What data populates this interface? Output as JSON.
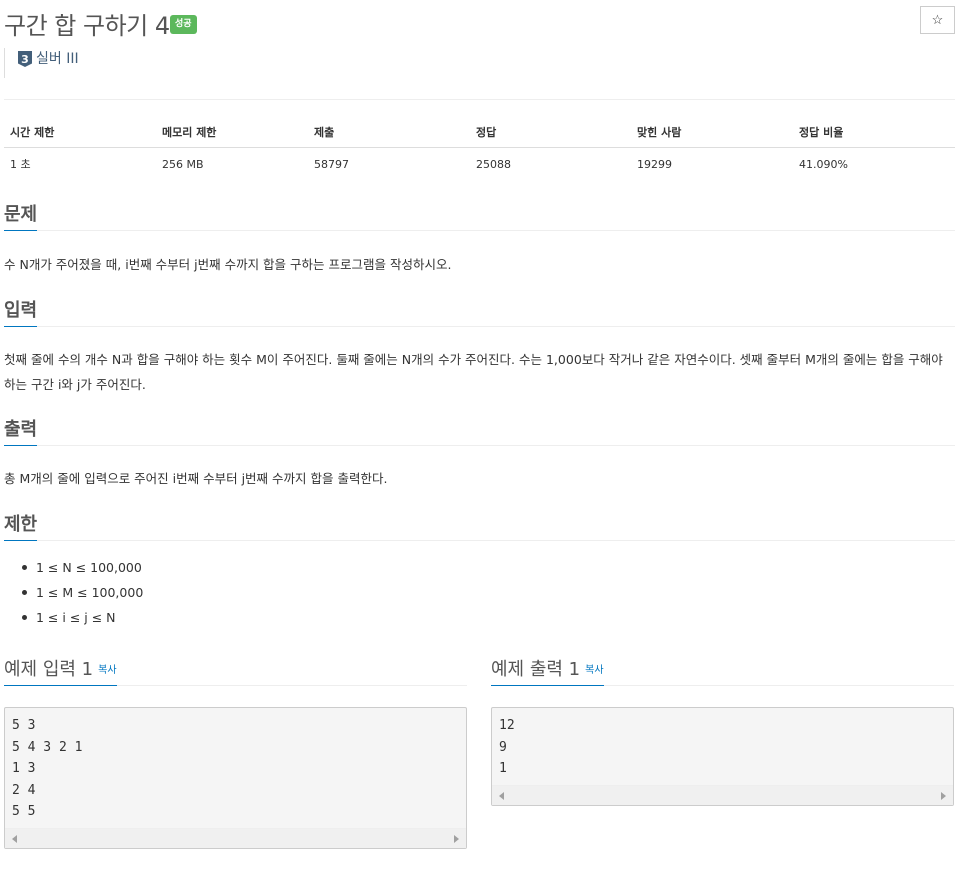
{
  "problem": {
    "title": "구간 합 구하기 4",
    "badge": "성공",
    "star": "☆",
    "tier_number": "3",
    "tier_label": "실버 III",
    "colors": {
      "badge": "#5cb85c",
      "tier": "#435f7a",
      "accent": "#0076c0"
    }
  },
  "info_table": {
    "headers": [
      "시간 제한",
      "메모리 제한",
      "제출",
      "정답",
      "맞힌 사람",
      "정답 비율"
    ],
    "values": [
      "1 초",
      "256 MB",
      "58797",
      "25088",
      "19299",
      "41.090%"
    ]
  },
  "sections": {
    "description": {
      "title": "문제",
      "text": "수 N개가 주어졌을 때, i번째 수부터 j번째 수까지 합을 구하는 프로그램을 작성하시오."
    },
    "input": {
      "title": "입력",
      "text": "첫째 줄에 수의 개수 N과 합을 구해야 하는 횟수 M이 주어진다. 둘째 줄에는 N개의 수가 주어진다. 수는 1,000보다 작거나 같은 자연수이다. 셋째 줄부터 M개의 줄에는 합을 구해야 하는 구간 i와 j가 주어진다."
    },
    "output": {
      "title": "출력",
      "text": "총 M개의 줄에 입력으로 주어진 i번째 수부터 j번째 수까지 합을 출력한다."
    },
    "limits": {
      "title": "제한",
      "items": [
        "1 ≤ N ≤ 100,000",
        "1 ≤ M ≤ 100,000",
        "1 ≤ i ≤ j ≤ N"
      ]
    }
  },
  "examples": {
    "input": {
      "title": "예제 입력 1",
      "copy": "복사",
      "content": "5 3\n5 4 3 2 1\n1 3\n2 4\n5 5"
    },
    "output": {
      "title": "예제 출력 1",
      "copy": "복사",
      "content": "12\n9\n1"
    }
  }
}
